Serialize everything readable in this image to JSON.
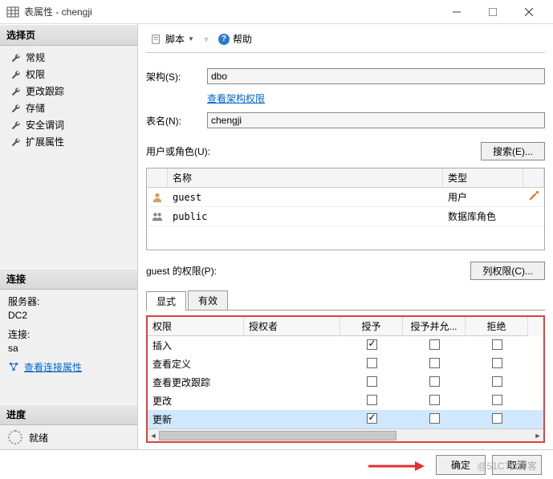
{
  "window": {
    "title": "表属性 - chengji"
  },
  "sidebar": {
    "select_page": "选择页",
    "nav": [
      "常规",
      "权限",
      "更改跟踪",
      "存储",
      "安全谓词",
      "扩展属性"
    ],
    "connection_header": "连接",
    "server_label": "服务器:",
    "server_value": "DC2",
    "conn_label": "连接:",
    "conn_value": "sa",
    "view_conn_props": "查看连接属性",
    "progress_header": "进度",
    "progress_status": "就绪"
  },
  "toolbar": {
    "script": "脚本",
    "help": "帮助"
  },
  "form": {
    "schema_label": "架构(S):",
    "schema_value": "dbo",
    "view_schema_perms": "查看架构权限",
    "table_label": "表名(N):",
    "table_value": "chengji",
    "users_label": "用户或角色(U):",
    "search_btn": "搜索(E)..."
  },
  "users_grid": {
    "cols": {
      "name": "名称",
      "type": "类型"
    },
    "rows": [
      {
        "name": "guest",
        "type": "用户"
      },
      {
        "name": "public",
        "type": "数据库角色"
      }
    ]
  },
  "perms": {
    "label_prefix": "guest 的权限(P):",
    "col_perms_btn": "列权限(C)...",
    "tabs": {
      "explicit": "显式",
      "effective": "有效"
    },
    "cols": {
      "perm": "权限",
      "grantor": "授权者",
      "grant": "授予",
      "withgrant": "授予并允...",
      "deny": "拒绝"
    },
    "rows": [
      {
        "name": "插入",
        "grant": true,
        "withgrant": false,
        "deny": false,
        "selected": false
      },
      {
        "name": "查看定义",
        "grant": false,
        "withgrant": false,
        "deny": false,
        "selected": false
      },
      {
        "name": "查看更改跟踪",
        "grant": false,
        "withgrant": false,
        "deny": false,
        "selected": false
      },
      {
        "name": "更改",
        "grant": false,
        "withgrant": false,
        "deny": false,
        "selected": false
      },
      {
        "name": "更新",
        "grant": true,
        "withgrant": false,
        "deny": false,
        "selected": true
      }
    ]
  },
  "footer": {
    "ok": "确定",
    "cancel": "取消"
  },
  "watermark": "@51CTO博客"
}
